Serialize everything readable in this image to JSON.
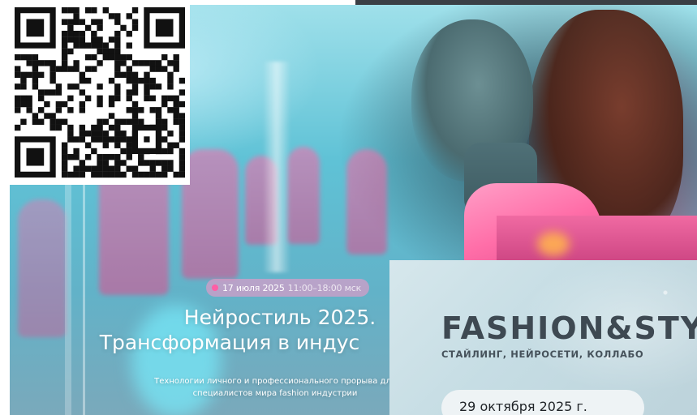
{
  "event": {
    "date": "17 июля 2025",
    "time": "11:00–18:00 мск",
    "title_line1": "Нейростиль 2025.",
    "title_line2": "Трансформация в индус",
    "subtitle": "Технологии личного и профессионального прорыва для специалистов мира fashion индустрии"
  },
  "fashion_card": {
    "title": "FASHION&STY",
    "subtitle": "СТАЙЛИНГ, НЕЙРОСЕТИ, КОЛЛАБО",
    "date": "29 октября 2025 г."
  },
  "colors": {
    "accent_pink": "#ff5ea5",
    "card_bg": "#c6dde4",
    "title_dark": "#3e4952"
  },
  "icons": [
    "qr-code"
  ]
}
